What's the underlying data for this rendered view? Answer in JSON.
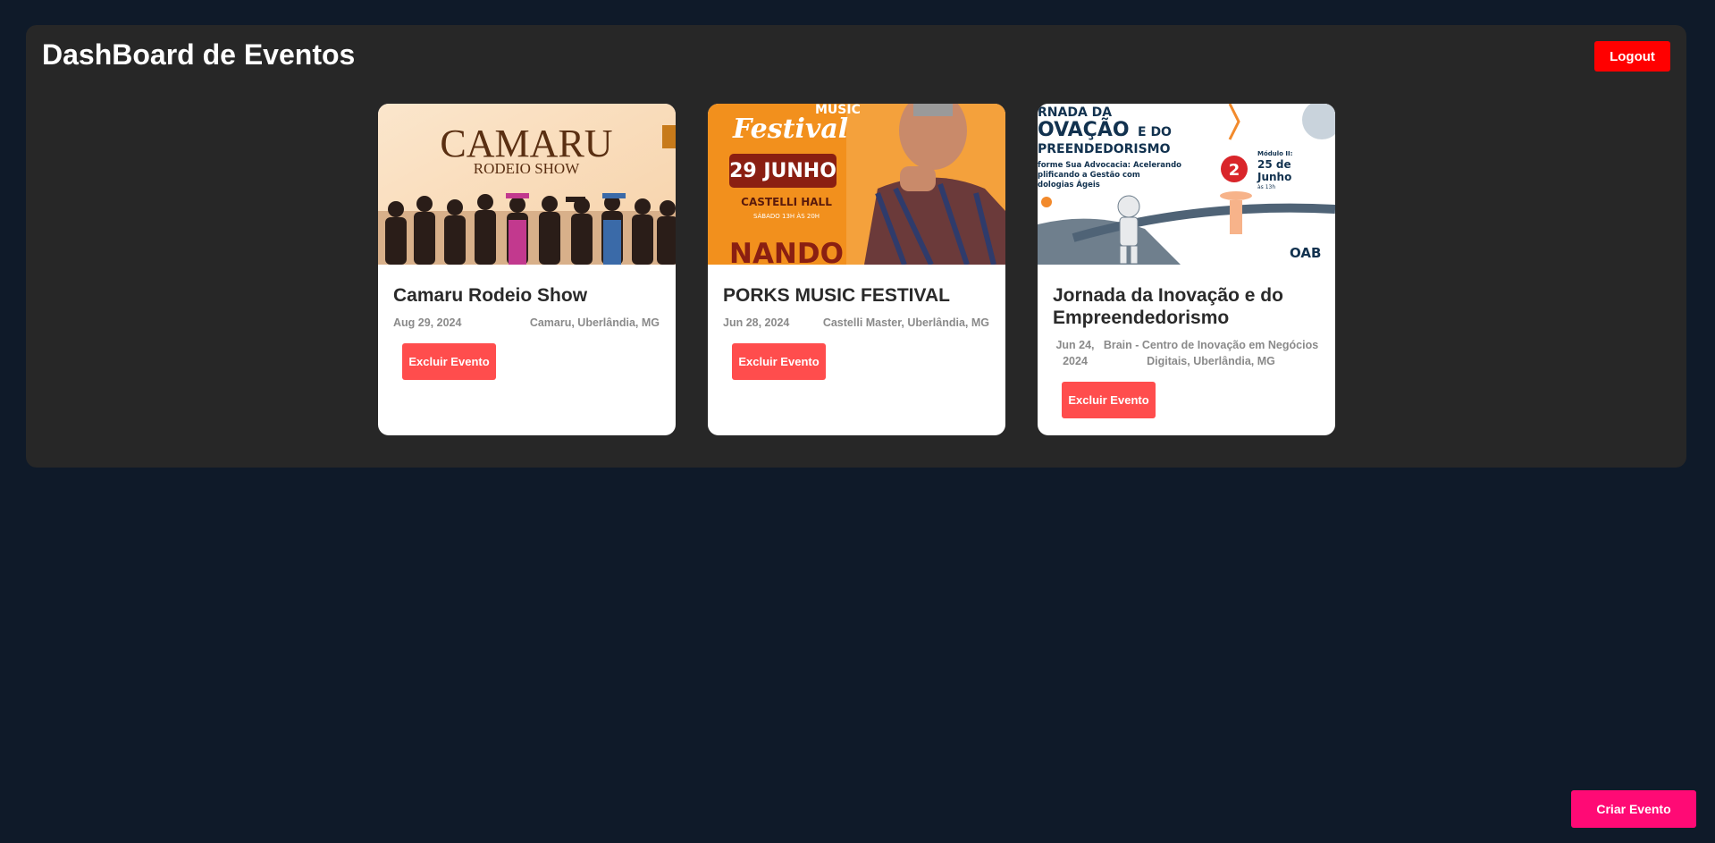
{
  "header": {
    "title": "DashBoard de Eventos",
    "logout_label": "Logout"
  },
  "events": [
    {
      "title": "Camaru Rodeio Show",
      "date": "Aug 29, 2024",
      "location": "Camaru, Uberlândia, MG",
      "delete_label": "Excluir Evento",
      "poster": {
        "line1": "CAMARU",
        "line2": "RODEIO SHOW"
      }
    },
    {
      "title": "PORKS MUSIC FESTIVAL",
      "date": "Jun 28, 2024",
      "location": "Castelli Master, Uberlândia, MG",
      "delete_label": "Excluir Evento",
      "poster": {
        "music": "MUSIC",
        "festival": "Festival",
        "date": "29 JUNHO",
        "venue": "CASTELLI HALL",
        "time": "SÁBADO 13H ÀS 20H",
        "artist": "NANDO"
      }
    },
    {
      "title": "Jornada da Inovação e do Empreendedorismo",
      "date": "Jun 24, 2024",
      "location": "Brain - Centro de Inovação em Negócios Digitais, Uberlândia, MG",
      "delete_label": "Excluir Evento",
      "poster": {
        "l1": "RNADA DA",
        "l2a": "OVAÇÃO",
        "l2b": "E DO",
        "l3": "PREENDEDORISMO",
        "l4": "forme Sua Advocacia: Acelerando",
        "l5": "plificando a Gestão com",
        "l6": "dologias Ágeis",
        "module": "Módulo II:",
        "num": "2",
        "day": "25 de",
        "month": "Junho",
        "time": "às 13h",
        "brand": "OAB"
      }
    }
  ],
  "create_label": "Criar Evento"
}
